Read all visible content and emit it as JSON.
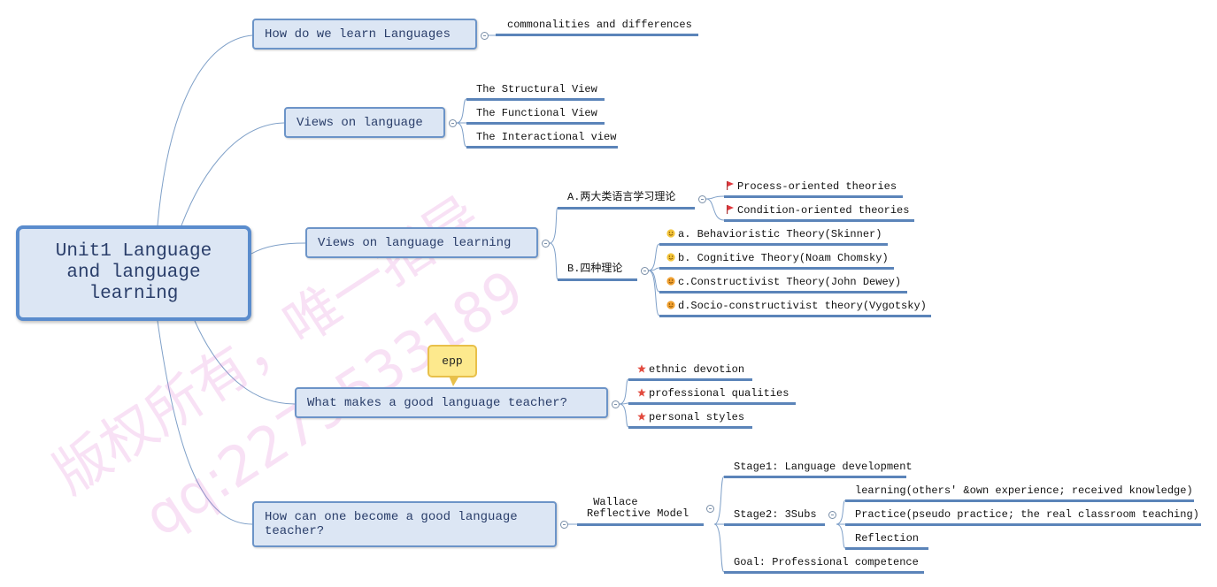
{
  "root": {
    "label": "Unit1 Language\nand language\n learning"
  },
  "colors": {
    "node_fill": "#dce6f4",
    "node_border": "#6c94c8",
    "underline": "#5b84b9",
    "callout_fill": "#fde98d",
    "flag": "#e0383e",
    "star": "#e24b3f",
    "watermark": "#e178d2"
  },
  "topics": [
    {
      "label": "How do we learn Languages",
      "children": [
        "commonalities and differences"
      ]
    },
    {
      "label": "Views on language",
      "children": [
        "The Structural View",
        "The Functional View",
        "The Interactional view"
      ]
    },
    {
      "label": "Views on language learning",
      "groups": [
        {
          "label": "A.两大类语言学习理论",
          "icon": "flag-icon",
          "children": [
            "Process-oriented theories",
            "Condition-oriented theories"
          ]
        },
        {
          "label": "B.四种理论",
          "icon": "smiley-icon",
          "children": [
            "a. Behavioristic Theory(Skinner)",
            "b. Cognitive Theory(Noam Chomsky)",
            "c.Constructivist Theory(John Dewey)",
            "d.Socio-constructivist theory(Vygotsky)"
          ]
        }
      ]
    },
    {
      "label": "What makes a good language teacher?",
      "callout": "epp",
      "icon": "star-icon",
      "children": [
        "ethnic devotion",
        "professional qualities",
        "personal styles"
      ]
    },
    {
      "label": "How can one become a good language\nteacher?",
      "model": {
        "label": " Wallace\nReflective Model",
        "children": [
          {
            "label": "Stage1: Language development"
          },
          {
            "label": "Stage2: 3Subs",
            "children": [
              "learning(others' &own experience; received knowledge)",
              "Practice(pseudo practice; the real classroom teaching)",
              "Reflection"
            ]
          },
          {
            "label": "Goal: Professional competence"
          }
        ]
      }
    }
  ],
  "watermark": {
    "line1": "版权所有，唯一指导",
    "line2": "qq:2279533189"
  }
}
